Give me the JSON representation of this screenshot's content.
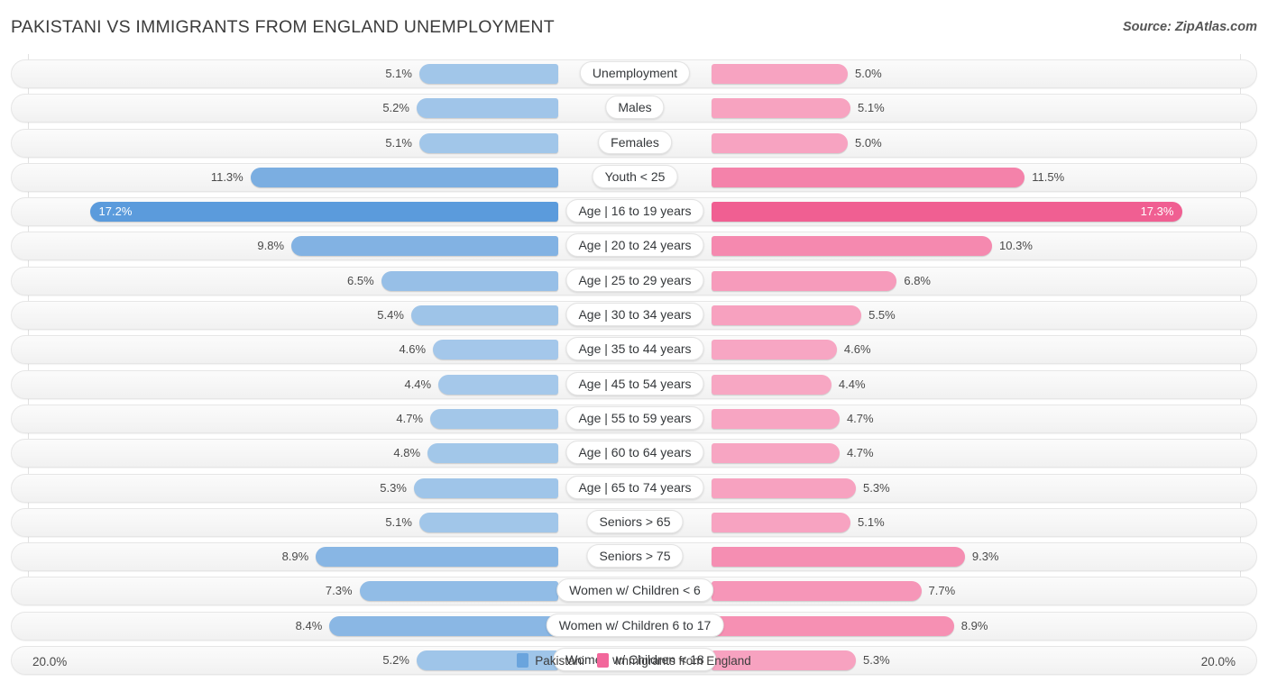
{
  "header": {
    "title": "PAKISTANI VS IMMIGRANTS FROM ENGLAND UNEMPLOYMENT",
    "source": "Source: ZipAtlas.com"
  },
  "footer": {
    "axis_left": "20.0%",
    "axis_right": "20.0%",
    "legend": [
      {
        "label": "Pakistani",
        "color": "#6aa4dd"
      },
      {
        "label": "Immigrants from England",
        "color": "#f2679b"
      }
    ]
  },
  "colors": {
    "left_light": "#a6c9ea",
    "left_mid": "#7fb0e2",
    "left_strong": "#5b9bdc",
    "right_light": "#f7a8c4",
    "right_mid": "#f587ad",
    "right_strong": "#f05f92",
    "row_bg": "#f6f6f6",
    "row_border": "#e6e6e6",
    "gridline": "#e2e2e2"
  },
  "chart_data": {
    "type": "bar",
    "orientation": "horizontal-diverging",
    "title": "PAKISTANI VS IMMIGRANTS FROM ENGLAND UNEMPLOYMENT",
    "xlabel": "",
    "ylabel": "",
    "axis_max_percent": 20.0,
    "grid": true,
    "legend_position": "bottom-center",
    "categories": [
      "Unemployment",
      "Males",
      "Females",
      "Youth < 25",
      "Age | 16 to 19 years",
      "Age | 20 to 24 years",
      "Age | 25 to 29 years",
      "Age | 30 to 34 years",
      "Age | 35 to 44 years",
      "Age | 45 to 54 years",
      "Age | 55 to 59 years",
      "Age | 60 to 64 years",
      "Age | 65 to 74 years",
      "Seniors > 65",
      "Seniors > 75",
      "Women w/ Children < 6",
      "Women w/ Children 6 to 17",
      "Women w/ Children < 18"
    ],
    "series": [
      {
        "name": "Pakistani",
        "color": "#6aa4dd",
        "values": [
          5.1,
          5.2,
          5.1,
          11.3,
          17.2,
          9.8,
          6.5,
          5.4,
          4.6,
          4.4,
          4.7,
          4.8,
          5.3,
          5.1,
          8.9,
          7.3,
          8.4,
          5.2
        ],
        "labels": [
          "5.1%",
          "5.2%",
          "5.1%",
          "11.3%",
          "17.2%",
          "9.8%",
          "6.5%",
          "5.4%",
          "4.6%",
          "4.4%",
          "4.7%",
          "4.8%",
          "5.3%",
          "5.1%",
          "8.9%",
          "7.3%",
          "8.4%",
          "5.2%"
        ]
      },
      {
        "name": "Immigrants from England",
        "color": "#f2679b",
        "values": [
          5.0,
          5.1,
          5.0,
          11.5,
          17.3,
          10.3,
          6.8,
          5.5,
          4.6,
          4.4,
          4.7,
          4.7,
          5.3,
          5.1,
          9.3,
          7.7,
          8.9,
          5.3
        ],
        "labels": [
          "5.0%",
          "5.1%",
          "5.0%",
          "11.5%",
          "17.3%",
          "10.3%",
          "6.8%",
          "5.5%",
          "4.6%",
          "4.4%",
          "4.7%",
          "4.7%",
          "5.3%",
          "5.1%",
          "9.3%",
          "7.7%",
          "8.9%",
          "5.3%"
        ]
      }
    ]
  }
}
